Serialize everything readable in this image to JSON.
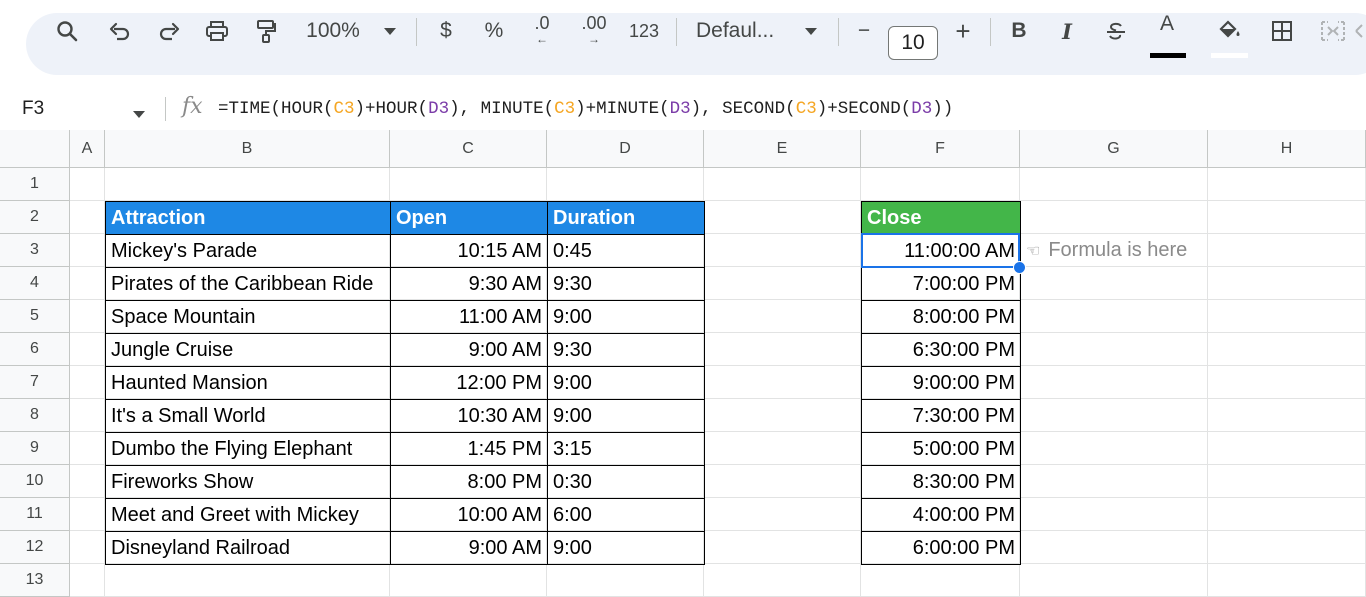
{
  "toolbar": {
    "zoom": "100%",
    "currency": "$",
    "percent": "%",
    "decrease_decimal": ".0",
    "increase_decimal": ".00",
    "number_format": "123",
    "font": "Defaul...",
    "font_size": "10",
    "minus": "−",
    "plus": "+",
    "bold": "B",
    "italic": "I",
    "text_color_letter": "A",
    "text_color": "#000000"
  },
  "formula_bar": {
    "name_box": "F3",
    "fx": "fx",
    "formula_parts": [
      "=TIME(HOUR(",
      "C3",
      ")+HOUR(",
      "D3",
      "), MINUTE(",
      "C3",
      ")+MINUTE(",
      "D3",
      "), SECOND(",
      "C3",
      ")+SECOND(",
      "D3",
      "))"
    ]
  },
  "columns": [
    "A",
    "B",
    "C",
    "D",
    "E",
    "F",
    "G",
    "H"
  ],
  "rows": [
    "1",
    "2",
    "3",
    "4",
    "5",
    "6",
    "7",
    "8",
    "9",
    "10",
    "11",
    "12",
    "13"
  ],
  "table": {
    "headers": [
      "Attraction",
      "Open",
      "Duration"
    ],
    "rows": [
      [
        "Mickey's Parade",
        "10:15 AM",
        "0:45"
      ],
      [
        "Pirates of the Caribbean Ride",
        "9:30 AM",
        "9:30"
      ],
      [
        "Space Mountain",
        "11:00 AM",
        "9:00"
      ],
      [
        "Jungle Cruise",
        "9:00 AM",
        "9:30"
      ],
      [
        "Haunted Mansion",
        "12:00 PM",
        "9:00"
      ],
      [
        "It's a Small World",
        "10:30 AM",
        "9:00"
      ],
      [
        "Dumbo the Flying Elephant",
        "1:45 PM",
        "3:15"
      ],
      [
        "Fireworks Show",
        "8:00 PM",
        "0:30"
      ],
      [
        "Meet and Greet with Mickey",
        "10:00 AM",
        "6:00"
      ],
      [
        "Disneyland Railroad",
        "9:00 AM",
        "9:00"
      ]
    ]
  },
  "close": {
    "header": "Close",
    "values": [
      "11:00:00 AM",
      "7:00:00 PM",
      "8:00:00 PM",
      "6:30:00 PM",
      "9:00:00 PM",
      "7:30:00 PM",
      "5:00:00 PM",
      "8:30:00 PM",
      "4:00:00 PM",
      "6:00:00 PM"
    ]
  },
  "note": {
    "icon": "pointing-hand-icon",
    "text": "Formula is here"
  },
  "colors": {
    "header_blue": "#1e88e5",
    "header_green": "#43b649",
    "selection": "#1a73e8",
    "ref_c3": "#f5a623",
    "ref_d3": "#7b3ca8"
  }
}
